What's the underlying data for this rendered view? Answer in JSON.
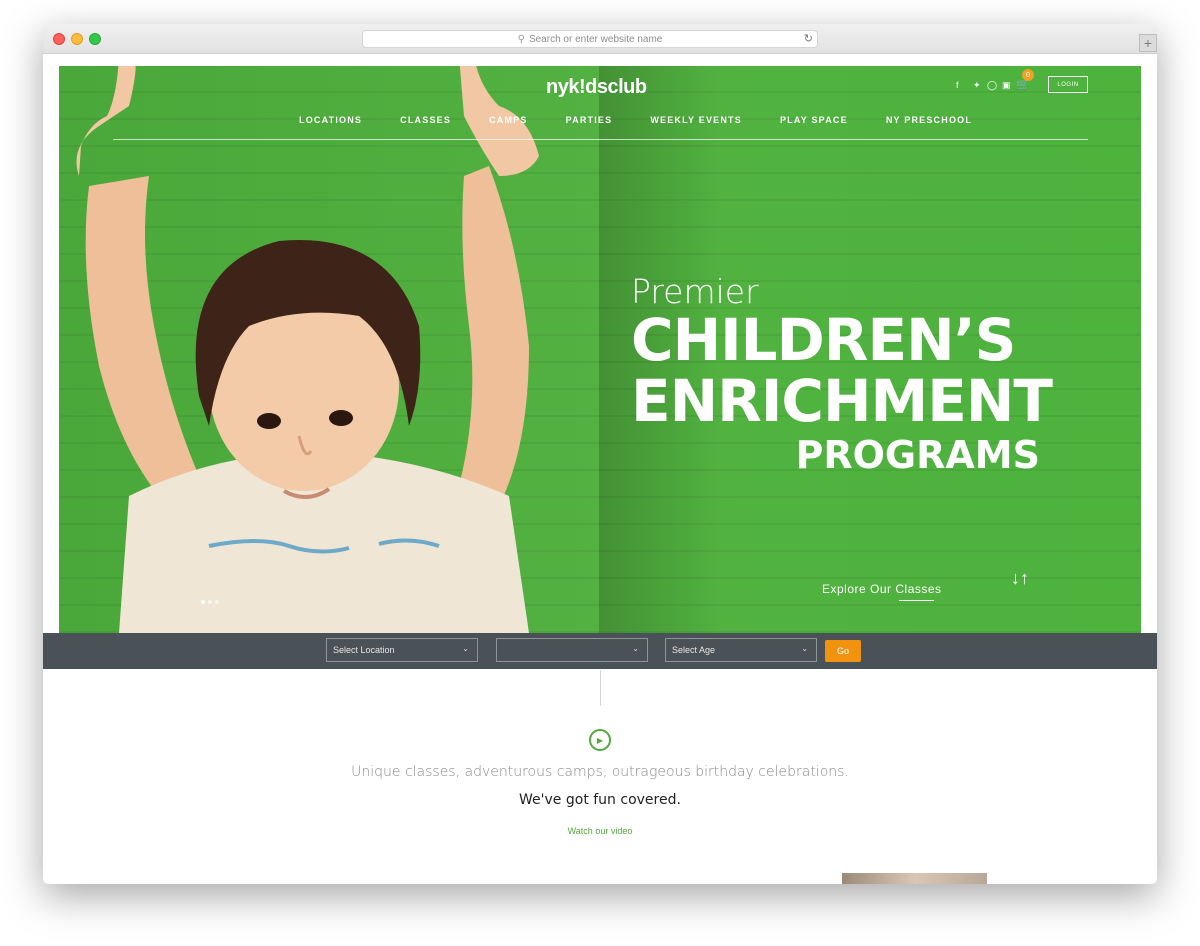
{
  "browser": {
    "url_placeholder": "Search or enter website name"
  },
  "header": {
    "logo": "nyk!dsclub",
    "cart_count": "0",
    "login": "LOGIN",
    "social_icons": [
      "facebook-icon",
      "twitter-icon",
      "instagram-icon",
      "linkedin-icon"
    ]
  },
  "nav": {
    "items": [
      "LOCATIONS",
      "CLASSES",
      "CAMPS",
      "PARTIES",
      "WEEKLY EVENTS",
      "PLAY SPACE",
      "NY PRESCHOOL"
    ]
  },
  "hero": {
    "line1": "Premier",
    "line2": "CHILDREN’S",
    "line3": "ENRICHMENT",
    "line4": "PROGRAMS",
    "cta": "Explore Our Classes"
  },
  "filters": {
    "location": "Select Location",
    "middle": "",
    "age": "Select Age",
    "go": "Go"
  },
  "intro": {
    "tagline": "Unique classes, adventurous camps, outrageous birthday celebrations.",
    "headline": "We've got fun covered.",
    "video_link": "Watch our video"
  },
  "colors": {
    "hero_green": "#52b140",
    "accent_green": "#55a83b",
    "go_orange": "#f2930f",
    "filter_bar": "#4b5257"
  }
}
